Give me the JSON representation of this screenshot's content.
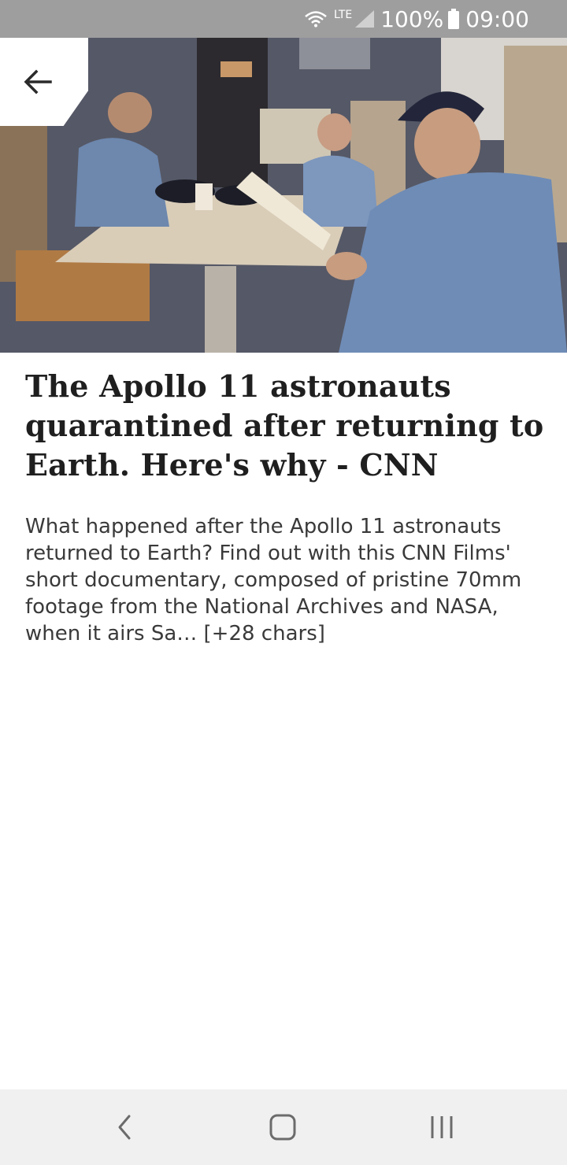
{
  "status_bar": {
    "network": "LTE",
    "battery": "100%",
    "time": "09:00",
    "icons": [
      "wifi-icon",
      "signal-icon",
      "battery-icon"
    ]
  },
  "hero": {
    "image": "photo of three astronauts in blue flight suits seated in a quarantine facility, one reading a newspaper"
  },
  "toolbar": {
    "back_icon": "arrow-left-icon"
  },
  "article": {
    "title": "The Apollo 11 astronauts quarantined after returning to Earth. Here's why - CNN",
    "description": "What happened after the Apollo 11 astronauts returned to Earth? Find out with this CNN Films' short documentary, composed of pristine 70mm footage from the National Archives and NASA, when it airs Sa… [+28 chars]"
  },
  "nav_bar": {
    "icons": [
      "nav-back-icon",
      "nav-home-icon",
      "nav-recent-apps-icon"
    ]
  },
  "colors": {
    "status_bar": "#9e9e9e",
    "title_text": "#1f1f1f",
    "body_text": "#3a3a3a",
    "nav_bar": "#f0f0f0"
  }
}
